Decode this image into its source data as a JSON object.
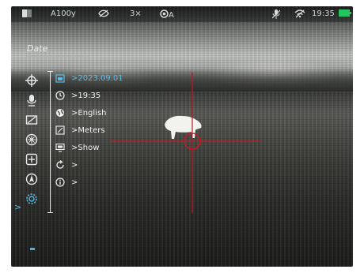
{
  "status_bar": {
    "profile": "A100y",
    "zoom": "3×",
    "calibration": "A",
    "time": "19:35",
    "battery_color": "#22c55e"
  },
  "menu": {
    "section_title": "Date",
    "selected_index": 7,
    "left_icons": [
      "crosshair-icon",
      "microphone-icon",
      "display-icon",
      "sun-icon",
      "plus-box-icon",
      "compass-icon",
      "gear-icon"
    ],
    "rows": [
      {
        "icon": "calendar-icon",
        "text": "2023.09.01",
        "active": true
      },
      {
        "icon": "clock-icon",
        "text": "19:35",
        "active": false
      },
      {
        "icon": "globe-icon",
        "text": "English",
        "active": false
      },
      {
        "icon": "ruler-icon",
        "text": "Meters",
        "active": false
      },
      {
        "icon": "monitor-icon",
        "text": "Show",
        "active": false
      },
      {
        "icon": "reset-icon",
        "text": "",
        "active": false
      },
      {
        "icon": "info-icon",
        "text": "",
        "active": false
      }
    ]
  },
  "colors": {
    "accent": "#56b7e0",
    "reticle": "#c01a22"
  }
}
